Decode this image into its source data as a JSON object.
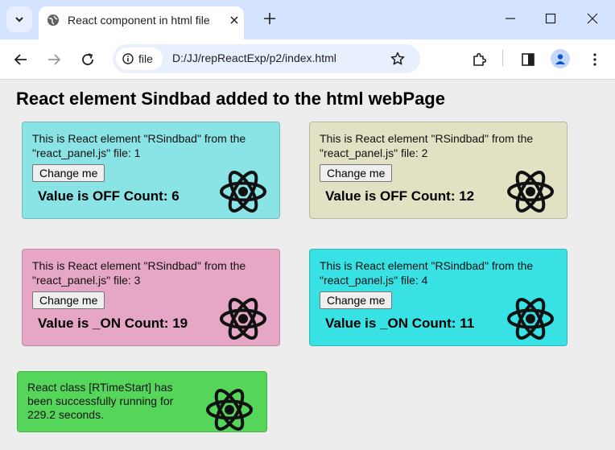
{
  "browser": {
    "tab_title": "React component in html file",
    "site_chip": "file",
    "url": "D:/JJ/repReactExp/p2/index.html"
  },
  "page": {
    "heading": "React element Sindbad added to the html webPage",
    "panels": [
      {
        "desc": "This is React element \"RSindbad\" from the \"react_panel.js\" file: 1",
        "button": "Change me",
        "value": "Value is OFF Count: 6",
        "color": "#8ae3e4"
      },
      {
        "desc": "This is React element \"RSindbad\" from the \"react_panel.js\" file: 2",
        "button": "Change me",
        "value": "Value is OFF Count: 12",
        "color": "#e3e1c3"
      },
      {
        "desc": "This is React element \"RSindbad\" from the \"react_panel.js\" file: 3",
        "button": "Change me",
        "value": "Value is _ON Count: 19",
        "color": "#e6a6c6"
      },
      {
        "desc": "This is React element \"RSindbad\" from the \"react_panel.js\" file: 4",
        "button": "Change me",
        "value": "Value is _ON Count: 11",
        "color": "#38e1e3"
      }
    ],
    "status": {
      "text": "React class [RTimeStart] has been successfully running for 229.2 seconds.",
      "color": "#55d65b"
    }
  },
  "icons": {
    "favicon": "globe-icon",
    "logo": "react-logo-icon"
  }
}
